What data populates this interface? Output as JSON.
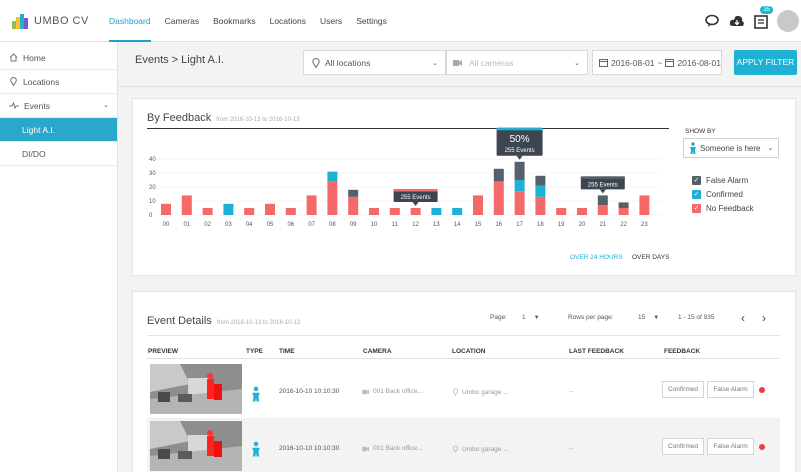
{
  "brand": {
    "name": "UMBO CV"
  },
  "nav": [
    {
      "label": "Dashboard",
      "active": true
    },
    {
      "label": "Cameras"
    },
    {
      "label": "Bookmarks"
    },
    {
      "label": "Locations"
    },
    {
      "label": "Users"
    },
    {
      "label": "Settings"
    }
  ],
  "topbar": {
    "notification_count": "35",
    "icons": [
      "chat-icon",
      "cloud-download-icon",
      "notification-list-icon",
      "avatar"
    ]
  },
  "sidebar": {
    "items": [
      {
        "label": "Home",
        "icon": "home-icon"
      },
      {
        "label": "Locations",
        "icon": "pin-icon"
      },
      {
        "label": "Events",
        "icon": "pulse-icon",
        "expanded": true
      }
    ],
    "sub_items": [
      {
        "label": "Light A.I.",
        "active": true
      },
      {
        "label": "DI/DO"
      }
    ]
  },
  "page": {
    "title": "Events > Light A.I."
  },
  "filters": {
    "location": "All locations",
    "camera_placeholder": "All cameras",
    "date_from": "2016-08-01",
    "date_sep": "~",
    "date_to": "2016-08-01",
    "apply_label": "APPLY FILTER"
  },
  "feedback_card": {
    "title": "By Feedback",
    "subtitle": "from 2016-10-13 to 2016-10-13",
    "show_by_label": "SHOW BY",
    "show_by_value": "Someone is here",
    "legend": [
      {
        "label": "False Alarm",
        "color": "#56606b"
      },
      {
        "label": "Confirmed",
        "color": "#1eb1d4"
      },
      {
        "label": "No Feedback",
        "color": "#f46a6b"
      }
    ],
    "tab_24h": "OVER 24 HOURS",
    "tab_days": "OVER DAYS"
  },
  "chart_data": {
    "type": "bar",
    "stacked": true,
    "categories": [
      "00",
      "01",
      "02",
      "03",
      "04",
      "05",
      "06",
      "07",
      "08",
      "09",
      "10",
      "11",
      "12",
      "13",
      "14",
      "15",
      "16",
      "17",
      "18",
      "19",
      "20",
      "21",
      "22",
      "23"
    ],
    "series": [
      {
        "name": "No Feedback",
        "color": "#f46a6b",
        "values": [
          8,
          14,
          5,
          0,
          5,
          8,
          5,
          14,
          24,
          13,
          5,
          5,
          5,
          0,
          0,
          14,
          24,
          17,
          13,
          5,
          5,
          7,
          5,
          14
        ]
      },
      {
        "name": "Confirmed",
        "color": "#1eb1d4",
        "values": [
          0,
          0,
          0,
          8,
          0,
          0,
          0,
          0,
          7,
          0,
          0,
          0,
          0,
          5,
          5,
          0,
          0,
          8,
          8,
          0,
          0,
          0,
          0,
          0
        ]
      },
      {
        "name": "False Alarm",
        "color": "#56606b",
        "values": [
          0,
          0,
          0,
          0,
          0,
          0,
          0,
          0,
          0,
          5,
          0,
          0,
          0,
          0,
          0,
          0,
          9,
          13,
          7,
          0,
          0,
          7,
          4,
          0
        ]
      }
    ],
    "y_ticks": [
      0,
      10,
      20,
      30,
      40
    ],
    "ylim": [
      0,
      45
    ],
    "tooltips": [
      {
        "hour": "12",
        "text": "255 Events",
        "top_color": "#f46a6b"
      },
      {
        "hour": "17",
        "pct": "50%",
        "text": "255 Events",
        "top_color": "#1eb1d4"
      },
      {
        "hour": "21",
        "text": "255 Events",
        "top_color": "#56606b"
      }
    ],
    "grid": true
  },
  "details": {
    "title": "Event Details",
    "subtitle": "from 2016-10-13 to 2016-10-13",
    "page_label": "Page:",
    "page_value": "1",
    "rows_label": "Rows per page:",
    "rows_value": "15",
    "range": "1 - 15 of 935",
    "columns": [
      "PREVIEW",
      "TYPE",
      "TIME",
      "CAMERA",
      "LOCATION",
      "LAST FEEDBACK",
      "FEEDBACK"
    ],
    "rows": [
      {
        "time": "2016-10-10  10:10:30",
        "camera": "001 Back office...",
        "location": "Umbo garage ...",
        "last_feedback": "--",
        "btn_confirm": "Confirmed",
        "btn_false": "False Alarm"
      },
      {
        "time": "2016-10-10  10:10:30",
        "camera": "001 Back office...",
        "location": "Umbo garage ...",
        "last_feedback": "--",
        "btn_confirm": "Confirmed",
        "btn_false": "False Alarm"
      }
    ]
  }
}
